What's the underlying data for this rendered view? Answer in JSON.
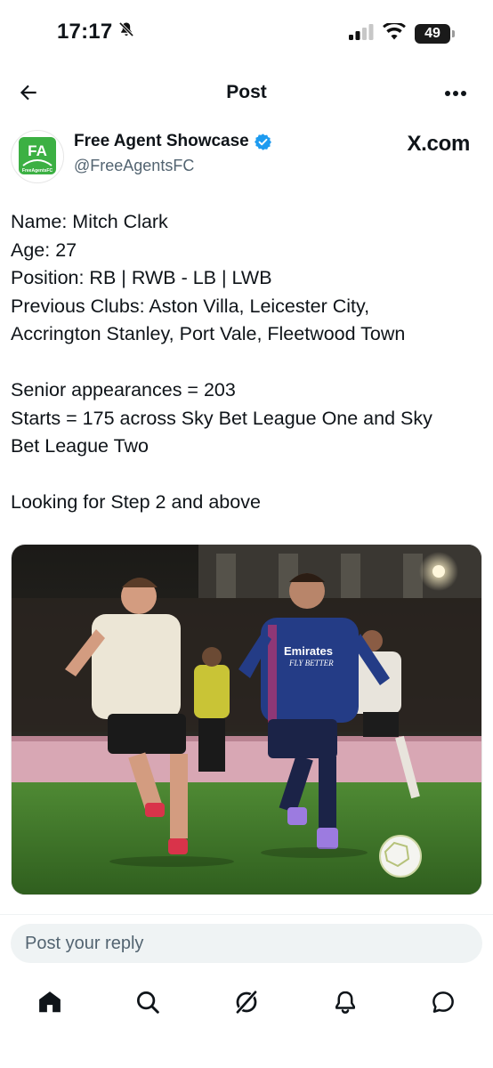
{
  "status_bar": {
    "time": "17:17",
    "battery": "49",
    "icons": [
      "bell-slash-icon",
      "cellular-signal-icon",
      "wifi-icon",
      "battery-icon"
    ]
  },
  "header": {
    "title": "Post",
    "back_icon": "arrow-left-icon",
    "more_icon": "ellipsis-icon"
  },
  "author": {
    "display_name": "Free Agent Showcase",
    "handle": "@FreeAgentsFC",
    "verified": true,
    "avatar_initials": "FA",
    "avatar_caption": "FreeAgentsFC",
    "source": "X.com",
    "colors": {
      "avatar_green": "#3cb043",
      "verified_blue": "#1d9bf0"
    }
  },
  "tweet": {
    "lines": [
      "Name: Mitch Clark",
      "Age: 27",
      "Position: RB | RWB - LB | LWB",
      "Previous Clubs: Aston Villa, Leicester City,",
      "Accrington Stanley, Port Vale, Fleetwood Town",
      "",
      "Senior appearances = 203",
      "Starts = 175 across Sky Bet League One and Sky",
      "Bet League Two",
      "",
      "Looking for Step 2 and above"
    ]
  },
  "media": {
    "description": "football-match-photo",
    "shirt_text_1": "Emirates",
    "shirt_text_2": "FLY BETTER"
  },
  "reply": {
    "placeholder": "Post your reply"
  },
  "tabs": [
    {
      "name": "home",
      "icon": "home-icon",
      "active": true
    },
    {
      "name": "search",
      "icon": "search-icon",
      "active": false
    },
    {
      "name": "grok",
      "icon": "grok-icon",
      "active": false
    },
    {
      "name": "notifications",
      "icon": "bell-icon",
      "active": false
    },
    {
      "name": "messages",
      "icon": "chat-bubble-icon",
      "active": false
    }
  ]
}
